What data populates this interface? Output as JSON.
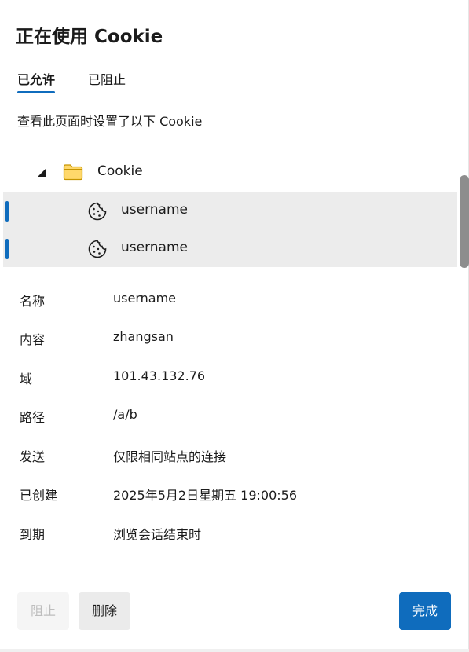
{
  "dialog": {
    "title": "正在使用 Cookie",
    "tabs": [
      {
        "label": "已允许",
        "active": true
      },
      {
        "label": "已阻止",
        "active": false
      }
    ],
    "description": "查看此页面时设置了以下 Cookie"
  },
  "tree": {
    "folder": {
      "label": "Cookie",
      "icon": "folder-icon",
      "expanded": true
    },
    "cookies": [
      {
        "label": "username",
        "icon": "cookie-icon",
        "selected": true
      },
      {
        "label": "username",
        "icon": "cookie-icon",
        "selected": true
      }
    ]
  },
  "details": {
    "rows": [
      {
        "key": "名称",
        "value": "username"
      },
      {
        "key": "内容",
        "value": "zhangsan"
      },
      {
        "key": "域",
        "value": "101.43.132.76"
      },
      {
        "key": "路径",
        "value": "/a/b"
      },
      {
        "key": "发送",
        "value": "仅限相同站点的连接"
      },
      {
        "key": "已创建",
        "value": "2025年5月2日星期五 19:00:56"
      },
      {
        "key": "到期",
        "value": "浏览会话结束时"
      }
    ]
  },
  "buttons": {
    "block_label": "阻止",
    "delete_label": "删除",
    "done_label": "完成"
  },
  "colors": {
    "accent": "#0f6cbd",
    "selected_row_bg": "#ececec"
  }
}
